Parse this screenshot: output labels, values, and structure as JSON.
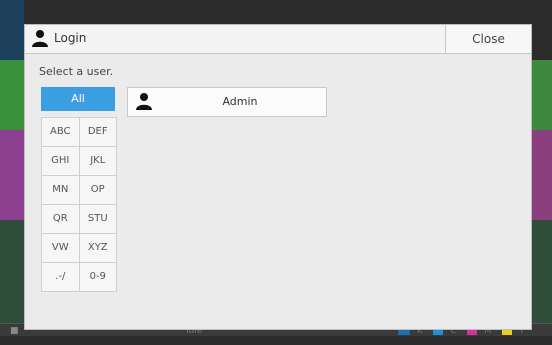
{
  "dialog": {
    "title": "Login",
    "close_label": "Close",
    "prompt": "Select a user."
  },
  "filters": {
    "all": "All",
    "rows": [
      [
        "ABC",
        "DEF"
      ],
      [
        "GHI",
        "JKL"
      ],
      [
        "MN",
        "OP"
      ],
      [
        "QR",
        "STU"
      ],
      [
        "VW",
        "XYZ"
      ],
      [
        ".-/",
        "0-9"
      ]
    ]
  },
  "users": [
    {
      "name": "Admin",
      "icon": "person-icon"
    }
  ],
  "status_bar": {
    "status": "Idle",
    "toner": [
      {
        "label": "K",
        "color": "#3a3a3a"
      },
      {
        "label": "C",
        "color": "#1e90d6"
      },
      {
        "label": "M",
        "color": "#d6339a"
      },
      {
        "label": "Y",
        "color": "#e6d21e"
      }
    ]
  },
  "colors": {
    "accent": "#3a9ee0"
  }
}
